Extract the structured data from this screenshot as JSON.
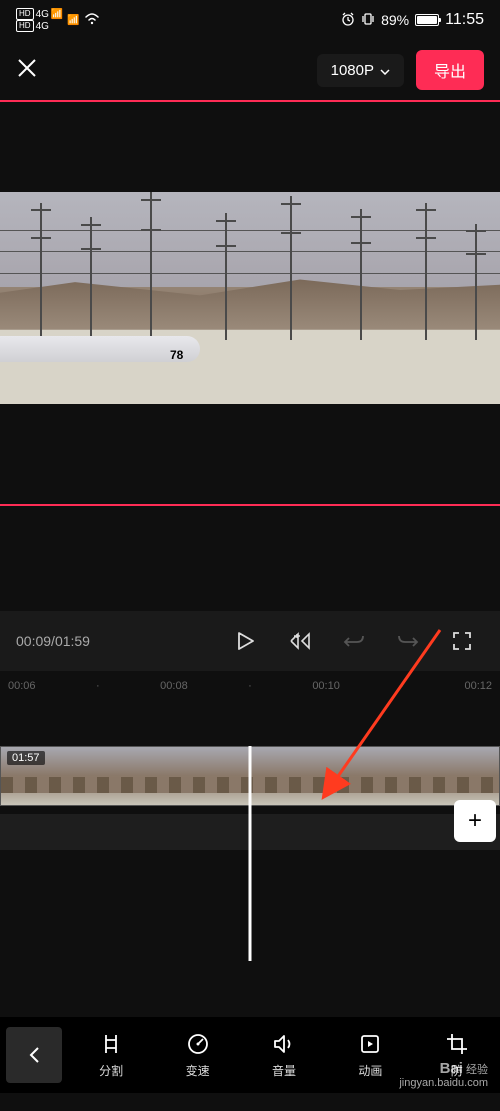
{
  "status": {
    "hd1": "HD",
    "hd2": "HD",
    "net1": "4G",
    "net2": "4G",
    "battery_pct": "89%",
    "time": "11:55"
  },
  "topbar": {
    "resolution": "1080P",
    "export": "导出"
  },
  "preview": {
    "train_number": "78"
  },
  "playback": {
    "current": "00:09",
    "total": "01:59",
    "sep": "/"
  },
  "ruler": {
    "t0": "00:06",
    "t1": "00:08",
    "t2": "00:10",
    "t3": "00:12",
    "dot": "·"
  },
  "timeline": {
    "clip_duration": "01:57",
    "add": "+"
  },
  "tools": {
    "split": "分割",
    "speed": "变速",
    "volume": "音量",
    "animation": "动画",
    "partial": "防"
  },
  "watermark": {
    "brand": "Bai",
    "brand2": "经验",
    "url": "jingyan.baidu.com"
  }
}
